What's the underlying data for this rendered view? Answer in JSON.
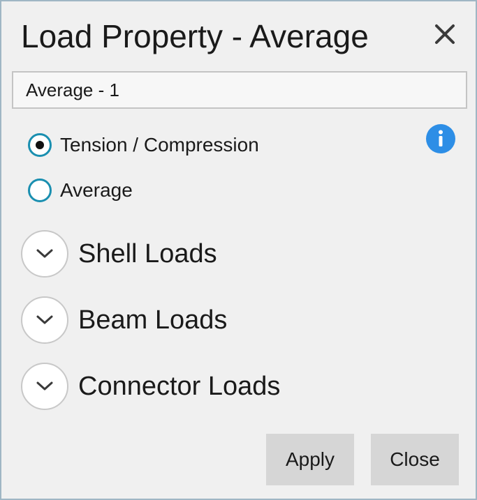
{
  "dialog": {
    "title": "Load Property - Average",
    "close_icon": "close-icon"
  },
  "name_field": {
    "value": "Average - 1"
  },
  "options": [
    {
      "label": "Tension / Compression",
      "selected": true
    },
    {
      "label": "Average",
      "selected": false
    }
  ],
  "info_icon": "info-icon",
  "sections": [
    {
      "label": "Shell Loads",
      "icon": "chevron-down-icon"
    },
    {
      "label": "Beam Loads",
      "icon": "chevron-down-icon"
    },
    {
      "label": "Connector Loads",
      "icon": "chevron-down-icon"
    }
  ],
  "buttons": {
    "apply": "Apply",
    "close": "Close"
  },
  "colors": {
    "background": "#f0f0f0",
    "radio_accent": "#1a8fb0",
    "info_blue": "#2d8ee6",
    "button_bg": "#d6d6d6",
    "border": "#9fb6c4"
  }
}
